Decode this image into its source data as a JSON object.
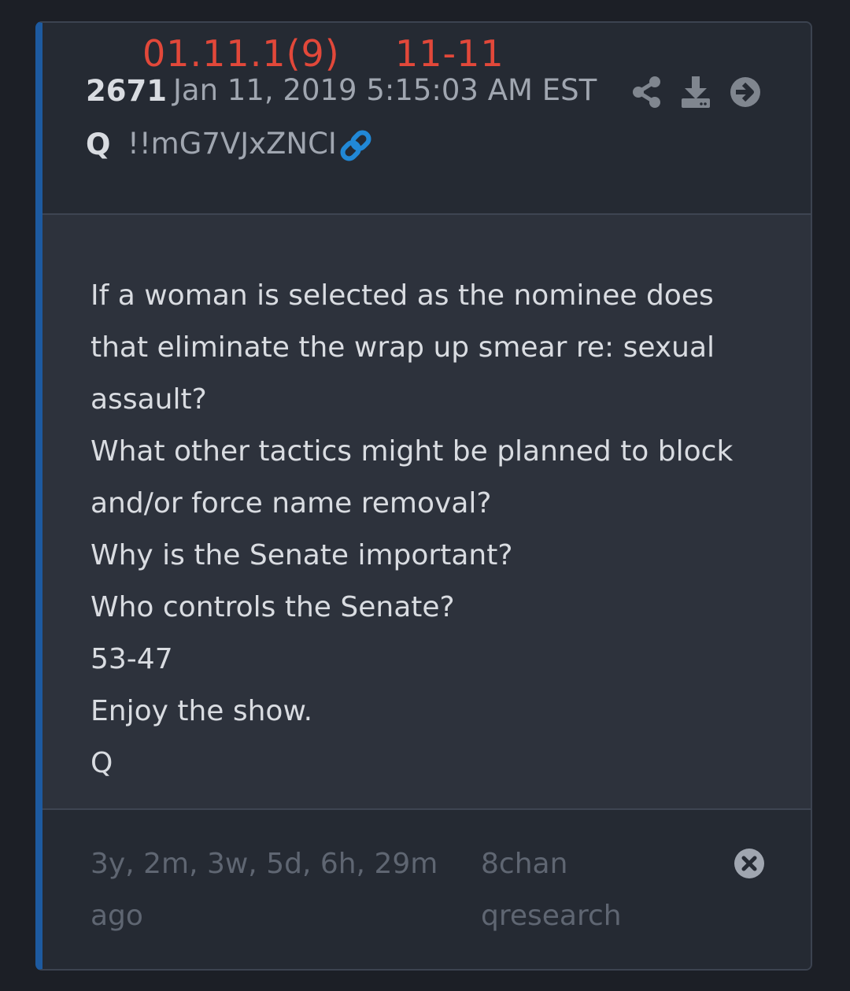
{
  "header": {
    "tag_date": "01.11.1(9)",
    "tag_time": "11-11",
    "post_number": "2671",
    "post_date": "Jan 11, 2019 5:15:03 AM EST",
    "author": "Q",
    "tripcode": "!!mG7VJxZNCI",
    "actions": [
      "share-icon",
      "download-icon",
      "arrow-right-circle-icon"
    ],
    "link_icon": "link-icon"
  },
  "post": {
    "lines": [
      "If a woman is selected as the nominee does that eliminate the wrap up smear re: sexual assault?",
      "What other tactics might be planned to block and/or force name removal?",
      "Why is the Senate important?",
      "Who controls the Senate?",
      "53-47",
      "Enjoy the show.",
      "Q"
    ]
  },
  "footer": {
    "age": "3y, 2m, 3w, 5d, 6h, 29m ago",
    "source": "8chan qresearch",
    "close_icon": "close-icon"
  },
  "colors": {
    "accent_red": "#e2483a",
    "accent_blue": "#1d5aa0",
    "link_blue": "#2188d6"
  }
}
